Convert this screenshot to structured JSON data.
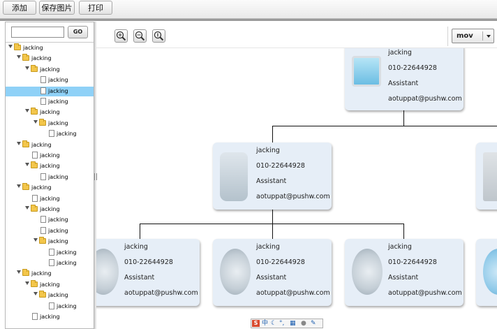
{
  "toolbar": {
    "add_label": "添加",
    "save_image_label": "保存图片",
    "print_label": "打印"
  },
  "sidebar": {
    "search": {
      "value": "",
      "placeholder": ""
    },
    "go_label": "GO",
    "tree": [
      {
        "label": "jacking",
        "type": "folder",
        "depth": 0,
        "expanded": true
      },
      {
        "label": "jacking",
        "type": "folder",
        "depth": 1,
        "expanded": true
      },
      {
        "label": "jacking",
        "type": "folder",
        "depth": 2,
        "expanded": true
      },
      {
        "label": "jacking",
        "type": "file",
        "depth": 3
      },
      {
        "label": "jacking",
        "type": "file",
        "depth": 3,
        "selected": true
      },
      {
        "label": "jacking",
        "type": "file",
        "depth": 3
      },
      {
        "label": "jacking",
        "type": "folder",
        "depth": 2,
        "expanded": true
      },
      {
        "label": "jacking",
        "type": "folder",
        "depth": 3,
        "expanded": true
      },
      {
        "label": "jacking",
        "type": "file",
        "depth": 4
      },
      {
        "label": "jacking",
        "type": "folder",
        "depth": 1,
        "expanded": true
      },
      {
        "label": "jacking",
        "type": "file",
        "depth": 2
      },
      {
        "label": "jacking",
        "type": "folder",
        "depth": 2,
        "expanded": true
      },
      {
        "label": "jacking",
        "type": "file",
        "depth": 3
      },
      {
        "label": "jacking",
        "type": "folder",
        "depth": 1,
        "expanded": true
      },
      {
        "label": "jacking",
        "type": "file",
        "depth": 2
      },
      {
        "label": "jacking",
        "type": "folder",
        "depth": 2,
        "expanded": true
      },
      {
        "label": "jacking",
        "type": "file",
        "depth": 3
      },
      {
        "label": "jacking",
        "type": "file",
        "depth": 3
      },
      {
        "label": "jacking",
        "type": "folder",
        "depth": 3,
        "expanded": true
      },
      {
        "label": "jacking",
        "type": "file",
        "depth": 4
      },
      {
        "label": "jacking",
        "type": "file",
        "depth": 4
      },
      {
        "label": "jacking",
        "type": "folder",
        "depth": 1,
        "expanded": true
      },
      {
        "label": "jacking",
        "type": "folder",
        "depth": 2,
        "expanded": true
      },
      {
        "label": "jacking",
        "type": "folder",
        "depth": 3,
        "expanded": true
      },
      {
        "label": "jacking",
        "type": "file",
        "depth": 4
      },
      {
        "label": "jacking",
        "type": "file",
        "depth": 2
      }
    ]
  },
  "zoom_tools": [
    "zoom-in-icon",
    "zoom-out-icon",
    "zoom-reset-icon"
  ],
  "mode_select": {
    "value": "mov"
  },
  "org_cards": [
    {
      "name": "jacking",
      "phone": "010-22644928",
      "title": "Assistant",
      "email": "aotuppat@pushw.com",
      "icon": "monitor-icon"
    },
    {
      "name": "jacking",
      "phone": "010-22644928",
      "title": "Assistant",
      "email": "aotuppat@pushw.com",
      "icon": "trash-icon"
    },
    {
      "name": "jacking",
      "phone": "010-22644928",
      "title": "Assistant",
      "email": "aotuppat@pushw.com",
      "icon": "compass-icon"
    },
    {
      "name": "jacking",
      "phone": "010-22644928",
      "title": "Assistant",
      "email": "aotuppat@pushw.com",
      "icon": "compass-icon"
    },
    {
      "name": "jacking",
      "phone": "010-22644928",
      "title": "Assistant",
      "email": "aotuppat@pushw.com",
      "icon": "compass-icon"
    }
  ],
  "ime_bar": {
    "lang_label": "中",
    "icons": [
      "sogou-icon",
      "moon-icon",
      "punctuation-icon",
      "keyboard-icon",
      "user-icon",
      "wrench-icon"
    ]
  }
}
